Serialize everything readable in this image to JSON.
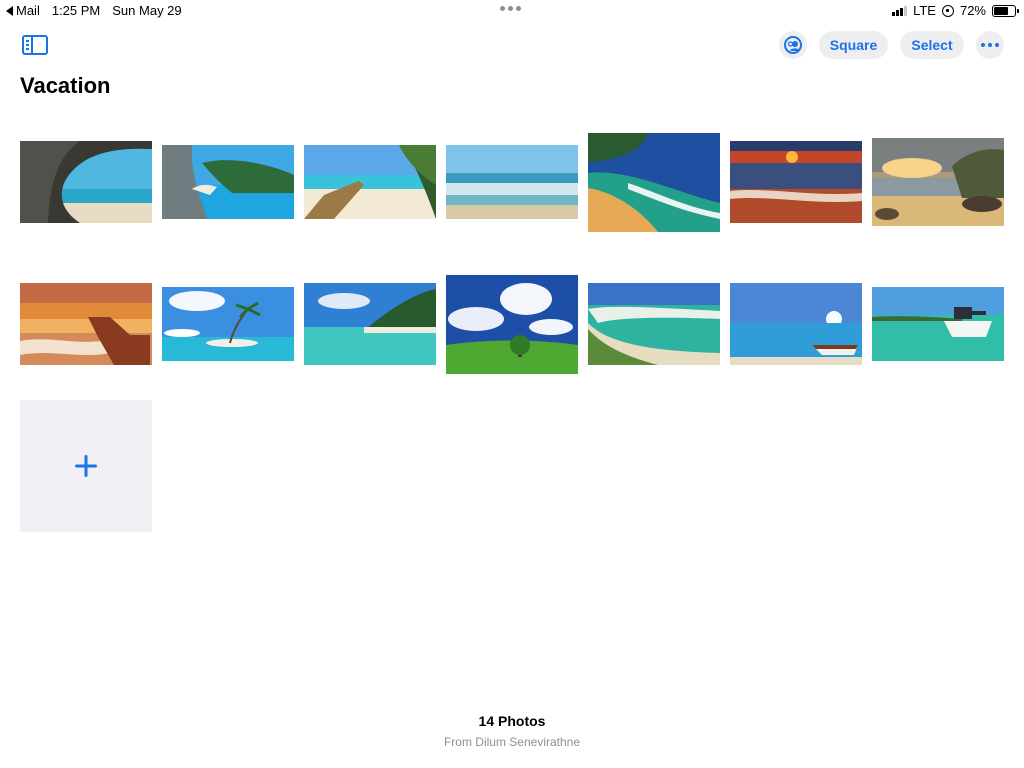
{
  "status_bar": {
    "back_app": "Mail",
    "time": "1:25 PM",
    "date": "Sun May 29",
    "network": "LTE",
    "battery": "72%",
    "battery_level": 0.72
  },
  "toolbar": {
    "sidebar_icon": "sidebar-icon",
    "share_icon": "shared-album-person-icon",
    "square_label": "Square",
    "select_label": "Select",
    "more_icon": "ellipsis-icon",
    "accent": "#1a73e8"
  },
  "album": {
    "title": "Vacation",
    "photo_count": "14 Photos",
    "from": "From Dilum Senevirathne"
  },
  "photos": [
    {
      "desc": "sea-cave-beach-thumbnail"
    },
    {
      "desc": "navagio-shipwreck-cove-thumbnail"
    },
    {
      "desc": "wooden-pier-palms-thumbnail"
    },
    {
      "desc": "ocean-waves-shore-thumbnail"
    },
    {
      "desc": "green-cove-beach-thumbnail"
    },
    {
      "desc": "sunset-red-waves-thumbnail"
    },
    {
      "desc": "rocky-beach-sunset-thumbnail"
    },
    {
      "desc": "orange-sunset-rocks-thumbnail"
    },
    {
      "desc": "palm-islet-blue-sky-thumbnail"
    },
    {
      "desc": "tropical-lagoon-palms-thumbnail"
    },
    {
      "desc": "green-field-tree-clouds-thumbnail"
    },
    {
      "desc": "curved-white-beach-thumbnail"
    },
    {
      "desc": "rowboat-blue-sea-thumbnail"
    },
    {
      "desc": "motorboat-clear-water-thumbnail"
    }
  ],
  "add_tile_icon": "plus-icon"
}
